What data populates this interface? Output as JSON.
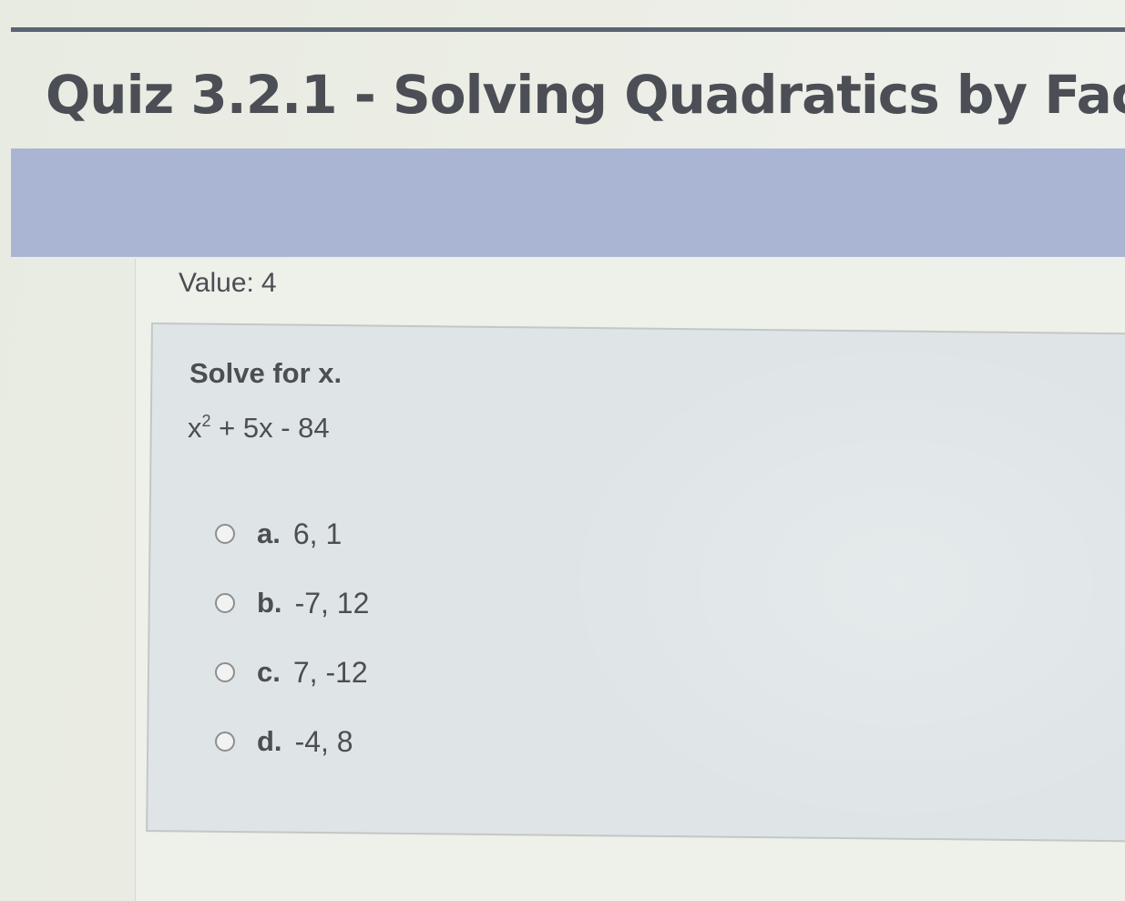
{
  "header": {
    "quiz_title": "Quiz 3.2.1 - Solving Quadratics by Fac"
  },
  "value": {
    "label": "Value:",
    "amount": "4"
  },
  "question": {
    "prompt": "Solve for x.",
    "equation_base": "x",
    "equation_exponent": "2",
    "equation_rest": " + 5x - 84"
  },
  "choices": [
    {
      "letter": "a.",
      "text": "6, 1"
    },
    {
      "letter": "b.",
      "text": "-7, 12"
    },
    {
      "letter": "c.",
      "text": "7, -12"
    },
    {
      "letter": "d.",
      "text": "-4, 8"
    }
  ],
  "colors": {
    "header_bar": "#a9b5d3",
    "title_text": "#4b4f55",
    "question_box": "#dfe5e7"
  }
}
